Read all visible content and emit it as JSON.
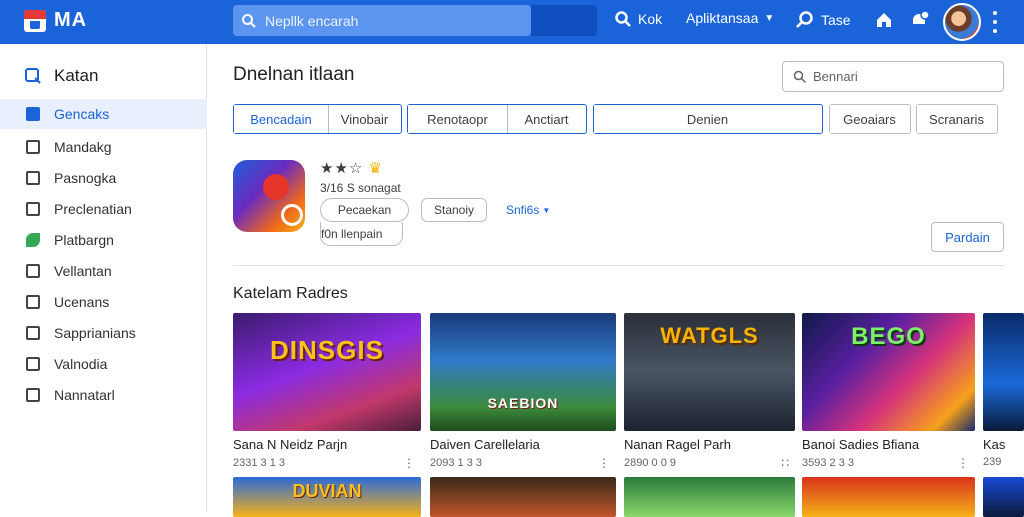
{
  "header": {
    "logo_text": "MA",
    "search_placeholder": "Nepllk encarah",
    "nav": {
      "kok": "Kok",
      "aplikasi": "Apliktansaa",
      "tase": "Tase"
    },
    "colors": {
      "bar": "#1a63d8",
      "accent": "#1a63d8"
    }
  },
  "sidebar": {
    "title": "Katan",
    "items": [
      {
        "label": "Gencaks",
        "icon": "store-icon",
        "active": true
      },
      {
        "label": "Mandakg",
        "icon": "grid-icon"
      },
      {
        "label": "Pasnogka",
        "icon": "bookmark-icon"
      },
      {
        "label": "Preclenatian",
        "icon": "image-icon"
      },
      {
        "label": "Platbargn",
        "icon": "leaf-icon"
      },
      {
        "label": "Vellantan",
        "icon": "chart-icon"
      },
      {
        "label": "Ucenans",
        "icon": "people-icon"
      },
      {
        "label": "Sapprianians",
        "icon": "window-icon"
      },
      {
        "label": "Valnodia",
        "icon": "calendar-icon"
      },
      {
        "label": "Nannatarl",
        "icon": "mail-icon"
      }
    ]
  },
  "main": {
    "title": "Dnelnan itlaan",
    "search_placeholder": "Bennari",
    "filters": {
      "group1": [
        "Bencadain",
        "Vinobair"
      ],
      "group2": [
        "Renotaopr",
        "Anctiart"
      ],
      "group3": [
        "Denien"
      ],
      "single1": "Geoaiars",
      "single2": "Scranaris"
    },
    "app": {
      "stars": "★★☆",
      "badge": "♛",
      "subtitle": "3/16 S sonagat",
      "pill_primary": "Pecaekan",
      "pill_secondary": "Stanoiy",
      "sort_link": "Snfi6s",
      "footer_text": "f0n llenpain",
      "action_label": "Pardain"
    },
    "section_title": "Katelam Radres",
    "cards": [
      {
        "thumb_text": "DINSGIS",
        "title": "Sana N Neidz Parjn",
        "meta": "2331 3 1 3"
      },
      {
        "thumb_text": "SAEBION",
        "title": "Daiven Carellelaria",
        "meta": "2093 1 3 3"
      },
      {
        "thumb_text": "WATGLS",
        "title": "Nanan Ragel Parh",
        "meta": "2890 0 0 9"
      },
      {
        "thumb_text": "BEGO",
        "title": "Banoi Sadies Bfiana",
        "meta": "3593 2 3 3"
      },
      {
        "thumb_text": "",
        "title": "Kas",
        "meta": "239"
      }
    ],
    "bottom_row_text": "DUVIAN"
  }
}
